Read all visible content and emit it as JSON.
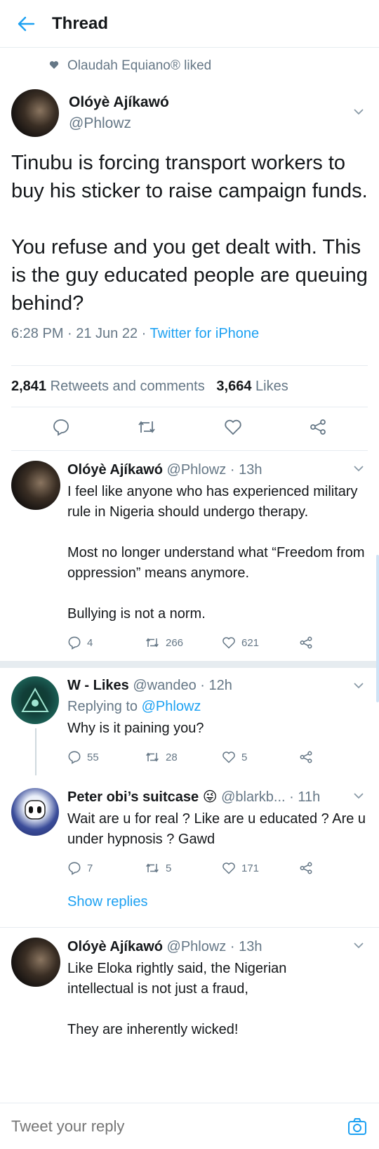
{
  "header": {
    "title": "Thread"
  },
  "social_context": {
    "text": "Olaudah Equiano® liked"
  },
  "main_tweet": {
    "author_name": "Olóyè Ajíkawó",
    "author_handle": "@Phlowz",
    "text": "Tinubu is forcing transport workers to buy his sticker to raise campaign funds.\n\nYou refuse and you get dealt with. This is the guy educated people are queuing behind?",
    "time": "6:28 PM · 21 Jun 22 · ",
    "source": "Twitter for iPhone",
    "retweets_count": "2,841",
    "retweets_label": "Retweets and comments",
    "likes_count": "3,664",
    "likes_label": "Likes"
  },
  "replies": [
    {
      "name": "Olóyè Ajíkawó",
      "handle_time": "@Phlowz · 13h",
      "replying_to_label": "",
      "replying_to_handle": "",
      "text": "I feel like anyone who has experienced military rule in Nigeria should undergo therapy.\n\nMost no longer understand what “Freedom from oppression” means anymore.\n\nBullying is not a norm.",
      "comments": "4",
      "retweets": "266",
      "likes": "621"
    },
    {
      "name": "W - Likes",
      "handle_time": "@wandeo · 12h",
      "replying_to_label": "Replying to ",
      "replying_to_handle": "@Phlowz",
      "text": "Why is it paining you?",
      "comments": "55",
      "retweets": "28",
      "likes": "5"
    },
    {
      "name": "Peter obi’s suitcase",
      "emoji": "😜",
      "handle_time": "@blarkb... · 11h",
      "text": "Wait are u for real ? Like are u educated ? Are u under hypnosis ? Gawd",
      "comments": "7",
      "retweets": "5",
      "likes": "171"
    },
    {
      "name": "Olóyè Ajíkawó",
      "handle_time": "@Phlowz · 13h",
      "text": "Like Eloka rightly said, the Nigerian intellectual is not just a fraud,\n\nThey are inherently wicked!"
    }
  ],
  "show_replies": "Show replies",
  "composer": {
    "placeholder": "Tweet your reply"
  },
  "colors": {
    "accent": "#1da1f2",
    "muted": "#657786",
    "divider": "#e6ecf0"
  }
}
